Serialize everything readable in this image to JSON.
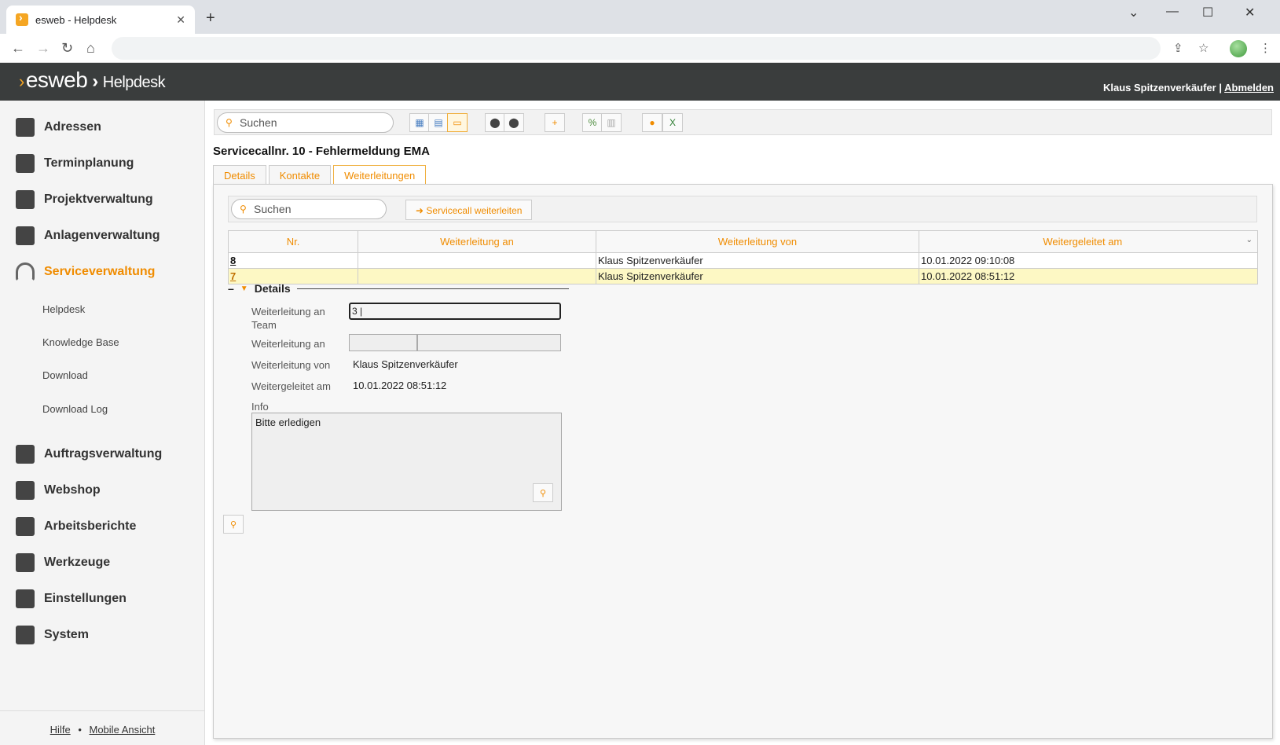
{
  "browser": {
    "tab_title": "esweb - Helpdesk",
    "tab_close": "✕",
    "new_tab": "+",
    "win_min": "—",
    "win_max": "☐",
    "win_close": "✕",
    "win_menu": "⌄"
  },
  "header": {
    "logo": "esweb",
    "section": "Helpdesk",
    "user": "Klaus Spitzenverkäufer",
    "separator": "|",
    "logout": "Abmelden"
  },
  "sidebar": {
    "items": [
      {
        "label": "Adressen"
      },
      {
        "label": "Terminplanung"
      },
      {
        "label": "Projektverwaltung"
      },
      {
        "label": "Anlagenverwaltung"
      },
      {
        "label": "Serviceverwaltung"
      },
      {
        "label": "Auftragsverwaltung"
      },
      {
        "label": "Webshop"
      },
      {
        "label": "Arbeitsberichte"
      },
      {
        "label": "Werkzeuge"
      },
      {
        "label": "Einstellungen"
      },
      {
        "label": "System"
      }
    ],
    "subitems": [
      {
        "label": "Helpdesk"
      },
      {
        "label": "Knowledge Base"
      },
      {
        "label": "Download"
      },
      {
        "label": "Download Log"
      }
    ],
    "footer": {
      "help": "Hilfe",
      "dot": "•",
      "mobile": "Mobile Ansicht"
    }
  },
  "toolbar": {
    "search_placeholder": "Suchen"
  },
  "page": {
    "title": "Servicecallnr. 10 - Fehlermeldung EMA",
    "tabs": [
      {
        "label": "Details"
      },
      {
        "label": "Kontakte"
      },
      {
        "label": "Weiterleitungen"
      }
    ]
  },
  "forwards": {
    "search_placeholder": "Suchen",
    "forward_button": "Servicecall weiterleiten",
    "columns": [
      "Nr.",
      "Weiterleitung an",
      "Weiterleitung von",
      "Weitergeleitet am"
    ],
    "rows": [
      {
        "nr": "8",
        "to": "",
        "from": "Klaus Spitzenverkäufer",
        "date": "10.01.2022 09:10:08"
      },
      {
        "nr": "7",
        "to": "",
        "from": "Klaus Spitzenverkäufer",
        "date": "10.01.2022 08:51:12"
      }
    ]
  },
  "details": {
    "heading": "Details",
    "label_team": "Weiterleitung an Team",
    "team_value": "3",
    "label_to": "Weiterleitung an",
    "label_from": "Weiterleitung von",
    "from_value": "Klaus Spitzenverkäufer",
    "label_date": "Weitergeleitet am",
    "date_value": "10.01.2022 08:51:12",
    "label_info": "Info",
    "info_value": "Bitte erledigen"
  },
  "colors": {
    "accent": "#f08c00",
    "header_bg": "#3a3d3d",
    "highlight_row": "#fdf8c4"
  }
}
